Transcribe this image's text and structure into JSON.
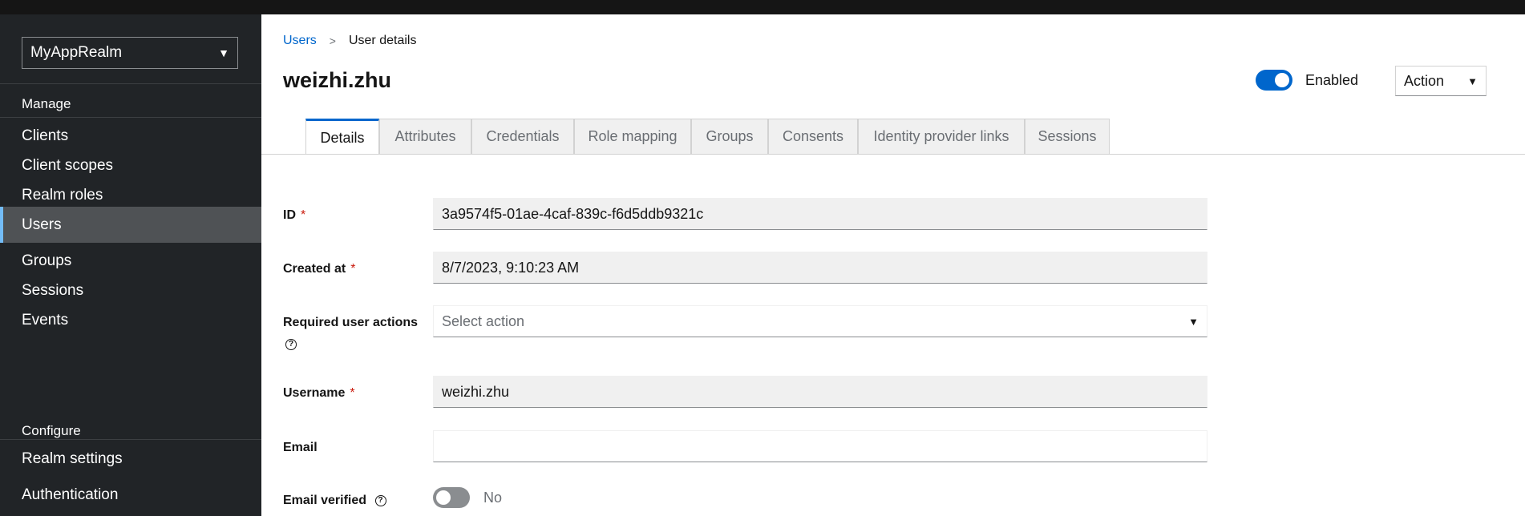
{
  "sidebar": {
    "realm": "MyAppRealm",
    "manage_label": "Manage",
    "manage_items": [
      {
        "label": "Clients"
      },
      {
        "label": "Client scopes"
      },
      {
        "label": "Realm roles"
      },
      {
        "label": "Users",
        "active": true
      },
      {
        "label": "Groups"
      },
      {
        "label": "Sessions"
      },
      {
        "label": "Events"
      }
    ],
    "configure_label": "Configure",
    "configure_items": [
      {
        "label": "Realm settings"
      },
      {
        "label": "Authentication"
      }
    ]
  },
  "breadcrumb": {
    "parent": "Users",
    "current": "User details"
  },
  "header": {
    "title": "weizhi.zhu",
    "enabled_label": "Enabled",
    "enabled": true,
    "action_label": "Action"
  },
  "tabs": [
    {
      "label": "Details",
      "active": true
    },
    {
      "label": "Attributes"
    },
    {
      "label": "Credentials"
    },
    {
      "label": "Role mapping"
    },
    {
      "label": "Groups"
    },
    {
      "label": "Consents"
    },
    {
      "label": "Identity provider links"
    },
    {
      "label": "Sessions"
    }
  ],
  "form": {
    "id": {
      "label": "ID",
      "value": "3a9574f5-01ae-4caf-839c-f6d5ddb9321c"
    },
    "created_at": {
      "label": "Created at",
      "value": "8/7/2023, 9:10:23 AM"
    },
    "required_actions": {
      "label": "Required user actions",
      "placeholder": "Select action"
    },
    "username": {
      "label": "Username",
      "value": "weizhi.zhu"
    },
    "email": {
      "label": "Email",
      "value": ""
    },
    "email_verified": {
      "label": "Email verified",
      "value_label": "No",
      "enabled": false
    }
  },
  "colors": {
    "accent": "#0066cc",
    "sidebar_bg": "#212427",
    "active_bar": "#73bcf7",
    "required": "#c9190b"
  }
}
